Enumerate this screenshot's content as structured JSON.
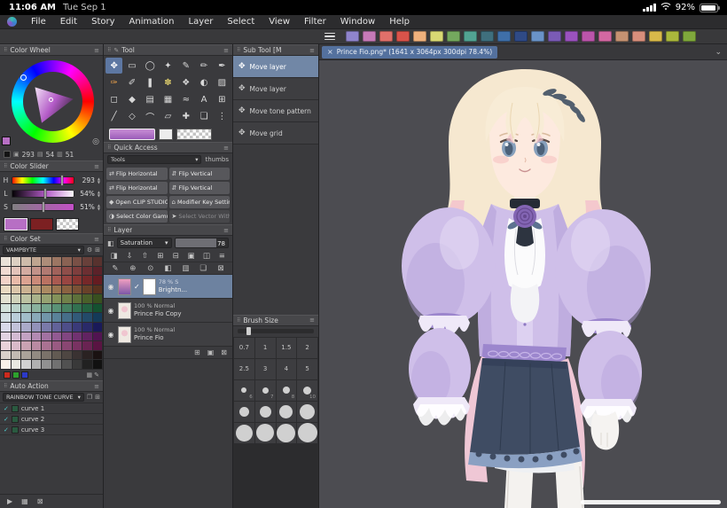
{
  "status_bar": {
    "time": "11:06 AM",
    "date": "Tue Sep 1",
    "battery_percent": "92%"
  },
  "menu_bar": {
    "items": [
      "File",
      "Edit",
      "Story",
      "Animation",
      "Layer",
      "Select",
      "View",
      "Filter",
      "Window",
      "Help"
    ]
  },
  "toolbar": {
    "swatch_colors": [
      "#8f84cc",
      "#c77ab8",
      "#e0706a",
      "#d9534a",
      "#efb17c",
      "#d9d973",
      "#74a85e",
      "#52a392",
      "#3f6f7d",
      "#3f6fa8",
      "#2f4a86",
      "#6a93c8",
      "#7a5bb5",
      "#9a52be",
      "#bb55ab",
      "#d468a2",
      "#c59272",
      "#d98f7c",
      "#d9b94a",
      "#aab83c",
      "#7fa83c"
    ]
  },
  "document": {
    "tab_title": "Prince Fio.png* (1641 x 3064px 300dpi 78.4%)"
  },
  "panels": {
    "color_wheel": {
      "title": "Color Wheel",
      "hue": "293",
      "sat": "54",
      "val": "51"
    },
    "color_slider": {
      "title": "Color Slider",
      "rows": [
        {
          "label": "H",
          "value": "293",
          "pct": 81
        },
        {
          "label": "L",
          "value": "54%",
          "pct": 54
        },
        {
          "label": "S",
          "value": "51%",
          "pct": 51
        }
      ]
    },
    "current_colors": {
      "main": "#b76fc4",
      "sub": "#7c2022"
    },
    "color_set": {
      "title": "Color Set",
      "set_name": "VAMPBYTE",
      "quick_colors": [
        "#cc2a1e",
        "#2da02d",
        "#2b39c8"
      ],
      "palette": [
        "#e9e1d8",
        "#dccfc2",
        "#cdbbaa",
        "#bfa590",
        "#ad8d79",
        "#9c7663",
        "#8a6253",
        "#795046",
        "#68403a",
        "#57322e",
        "#f0dad2",
        "#e3c3ba",
        "#d3aba1",
        "#c29289",
        "#b17a72",
        "#a1625b",
        "#8f4e4a",
        "#7e3e3d",
        "#6c2f32",
        "#5b2229",
        "#f2d2c8",
        "#e9baa9",
        "#dba291",
        "#cb8a79",
        "#ba7262",
        "#aa5a51",
        "#994642",
        "#883632",
        "#762829",
        "#651c21",
        "#e9dac2",
        "#dbc6aa",
        "#cbb292",
        "#bb9e7a",
        "#ab8a62",
        "#9b7651",
        "#8b6241",
        "#7a5135",
        "#694129",
        "#58321f",
        "#e2e1d1",
        "#cfd2ba",
        "#bcc2a2",
        "#a9b28a",
        "#96a272",
        "#83925a",
        "#70814a",
        "#5d713a",
        "#4a602a",
        "#38501f",
        "#d2e1da",
        "#bad2ca",
        "#a2c2b2",
        "#8ab29e",
        "#72a28a",
        "#5a9276",
        "#468162",
        "#327150",
        "#236140",
        "#145130",
        "#d2dde2",
        "#bacdd9",
        "#a2bdc9",
        "#8aaab9",
        "#7296a9",
        "#5a8299",
        "#466e89",
        "#325a79",
        "#234a69",
        "#143a59",
        "#d9d9e9",
        "#c2c2d9",
        "#aaaac9",
        "#9292b9",
        "#7a7aa9",
        "#626299",
        "#4e4e89",
        "#3a3a79",
        "#2a2a69",
        "#1a1a59",
        "#e1d2e1",
        "#d2bad2",
        "#c2a2c2",
        "#b28ab2",
        "#a272a2",
        "#925a92",
        "#814681",
        "#713271",
        "#612361",
        "#511451",
        "#e9d2d9",
        "#d9bac9",
        "#c9a2b2",
        "#b98aa2",
        "#a97292",
        "#995a82",
        "#894672",
        "#793262",
        "#692352",
        "#591442",
        "#d9d1c9",
        "#c2bab2",
        "#aaa29a",
        "#928a82",
        "#7a726a",
        "#625a52",
        "#4e4642",
        "#3a3232",
        "#2a2222",
        "#1a1212",
        "#f9f1e9",
        "#e9e9e1",
        "#d1d1d1",
        "#b1b1b1",
        "#919191",
        "#717171",
        "#515151",
        "#393939",
        "#212121",
        "#111111"
      ]
    },
    "auto_action": {
      "title": "Auto Action",
      "set_name": "RAINBOW TONE CURVE",
      "actions": [
        "curve 1",
        "curve 2",
        "curve 3"
      ]
    },
    "tool": {
      "title": "Tool",
      "selected_index": 0,
      "glyphs": [
        "✥",
        "▭",
        "◯",
        "✦",
        "✎",
        "✏",
        "✒",
        "✑",
        "✐",
        "❚",
        "✽",
        "❖",
        "◐",
        "▨",
        "◻",
        "◆",
        "▤",
        "▦",
        "≈",
        "A",
        "⊞",
        "╱",
        "◇",
        "⌒",
        "▱",
        "✚",
        "❏",
        "⋮"
      ]
    },
    "quick_access": {
      "title": "Quick Access",
      "set_label": "Tools",
      "view_label": "thumbs",
      "buttons": [
        {
          "icon": "⇄",
          "label": "Flip Horizontal"
        },
        {
          "icon": "⇵",
          "label": "Flip Vertical"
        },
        {
          "icon": "⇄",
          "label": "Flip Horizontal"
        },
        {
          "icon": "⇵",
          "label": "Flip Vertical"
        },
        {
          "icon": "◆",
          "label": "Open CLIP STUDIO"
        },
        {
          "icon": "⌂",
          "label": "Modifier Key Settin..."
        },
        {
          "icon": "◑",
          "label": "Select Color Gamut"
        },
        {
          "icon": "➤",
          "label": "Select Vector With...",
          "disabled": true
        }
      ]
    },
    "layer": {
      "title": "Layer",
      "blend_mode": "Saturation",
      "opacity": "78",
      "tool_icons_1": [
        "◨",
        "⇩",
        "⇧",
        "⊞",
        "⊟",
        "▣",
        "◫",
        "≡"
      ],
      "tool_icons_2": [
        "✎",
        "⊕",
        "⊙",
        "◧",
        "▥",
        "❏",
        "⊠"
      ],
      "rows": [
        {
          "blend_info": "78 % S",
          "name": "Brightn...",
          "selected": true,
          "type": "adjustment"
        },
        {
          "blend_info": "100 % Normal",
          "name": "Prince Fio Copy",
          "type": "art"
        },
        {
          "blend_info": "100 % Normal",
          "name": "Prince Fio",
          "type": "art"
        }
      ],
      "footer_icons": [
        "⊞",
        "▣",
        "⊠"
      ]
    },
    "sub_tool": {
      "title": "Sub Tool [M",
      "items": [
        {
          "label": "Move layer",
          "selected": true
        },
        {
          "label": "Move layer"
        },
        {
          "label": "Move tone pattern"
        },
        {
          "label": "Move grid"
        }
      ]
    },
    "brush_size": {
      "title": "Brush Size",
      "cells": [
        {
          "label": "0.7"
        },
        {
          "label": "1"
        },
        {
          "label": "1.5"
        },
        {
          "label": "2"
        },
        {
          "label": "2.5"
        },
        {
          "label": "3"
        },
        {
          "label": "4"
        },
        {
          "label": "5"
        },
        {
          "label": "6",
          "dot": 6
        },
        {
          "label": "7",
          "dot": 7
        },
        {
          "label": "8",
          "dot": 8
        },
        {
          "label": "10",
          "dot": 9
        },
        {
          "label": "",
          "dot": 11
        },
        {
          "label": "",
          "dot": 13
        },
        {
          "label": "",
          "dot": 15
        },
        {
          "label": "",
          "dot": 17
        },
        {
          "label": "",
          "dot": 19
        },
        {
          "label": "",
          "dot": 20
        },
        {
          "label": "",
          "dot": 21
        },
        {
          "label": "",
          "dot": 22
        }
      ]
    }
  },
  "col1_footer": {
    "icons": [
      "▶",
      "▦",
      "⊠"
    ]
  },
  "glyphs": {
    "grip": "⠿",
    "panel_menu": "≡",
    "target": "◎",
    "eye": "◉",
    "check": "✓",
    "move": "✥",
    "close": "×",
    "chevron_down": "⌄",
    "caret": "▾",
    "gear": "⚙",
    "plus": "⊞",
    "duplicate": "❐",
    "swatch_h": "▣",
    "swatch_s": "▤",
    "swatch_v": "▥",
    "blend": "◧"
  }
}
